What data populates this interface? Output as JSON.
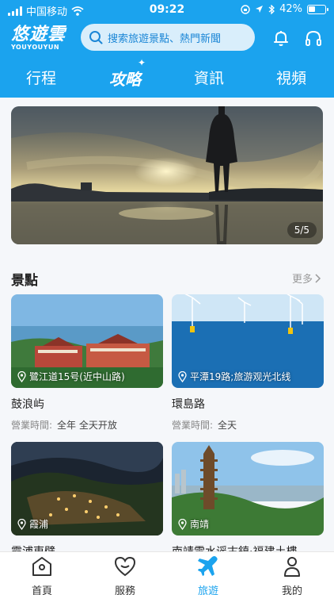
{
  "status_bar": {
    "carrier": "中国移动",
    "time": "09:22",
    "battery": "42%",
    "battery_level": 0.42
  },
  "header": {
    "logo_main": "悠遊雲",
    "logo_sub": "YOUYOUYUN",
    "search_placeholder": "搜索旅遊景點、熱門新聞",
    "tabs": [
      {
        "label": "行程"
      },
      {
        "label": "攻略",
        "active": true
      },
      {
        "label": "資訊"
      },
      {
        "label": "視頻"
      }
    ],
    "icons": [
      "bell-icon",
      "headphones-icon"
    ]
  },
  "banner": {
    "counter": "5/5"
  },
  "section": {
    "title": "景點",
    "more": "更多"
  },
  "attractions": [
    {
      "location": "鷺江道15号(近中山路)",
      "name": "鼓浪屿",
      "hours_label": "營業時間:",
      "hours": "全年 全天开放"
    },
    {
      "location": "平潭19路;旅游观光北线",
      "name": "環島路",
      "hours_label": "營業時間:",
      "hours": "全天"
    },
    {
      "location": "霞浦",
      "name": "霞浦東壁",
      "hours_label": "",
      "hours": ""
    },
    {
      "location": "南靖",
      "name": "南靖雲水谣古鎮·福建土樓",
      "hours_label": "",
      "hours": ""
    }
  ],
  "bottom_nav": [
    {
      "label": "首頁",
      "icon": "home-icon"
    },
    {
      "label": "服務",
      "icon": "heart-icon"
    },
    {
      "label": "旅遊",
      "icon": "plane-icon",
      "active": true
    },
    {
      "label": "我的",
      "icon": "person-icon"
    }
  ],
  "colors": {
    "accent": "#1ba3ee",
    "search_bg": "#d9eefb",
    "search_text": "#1b86d6"
  }
}
